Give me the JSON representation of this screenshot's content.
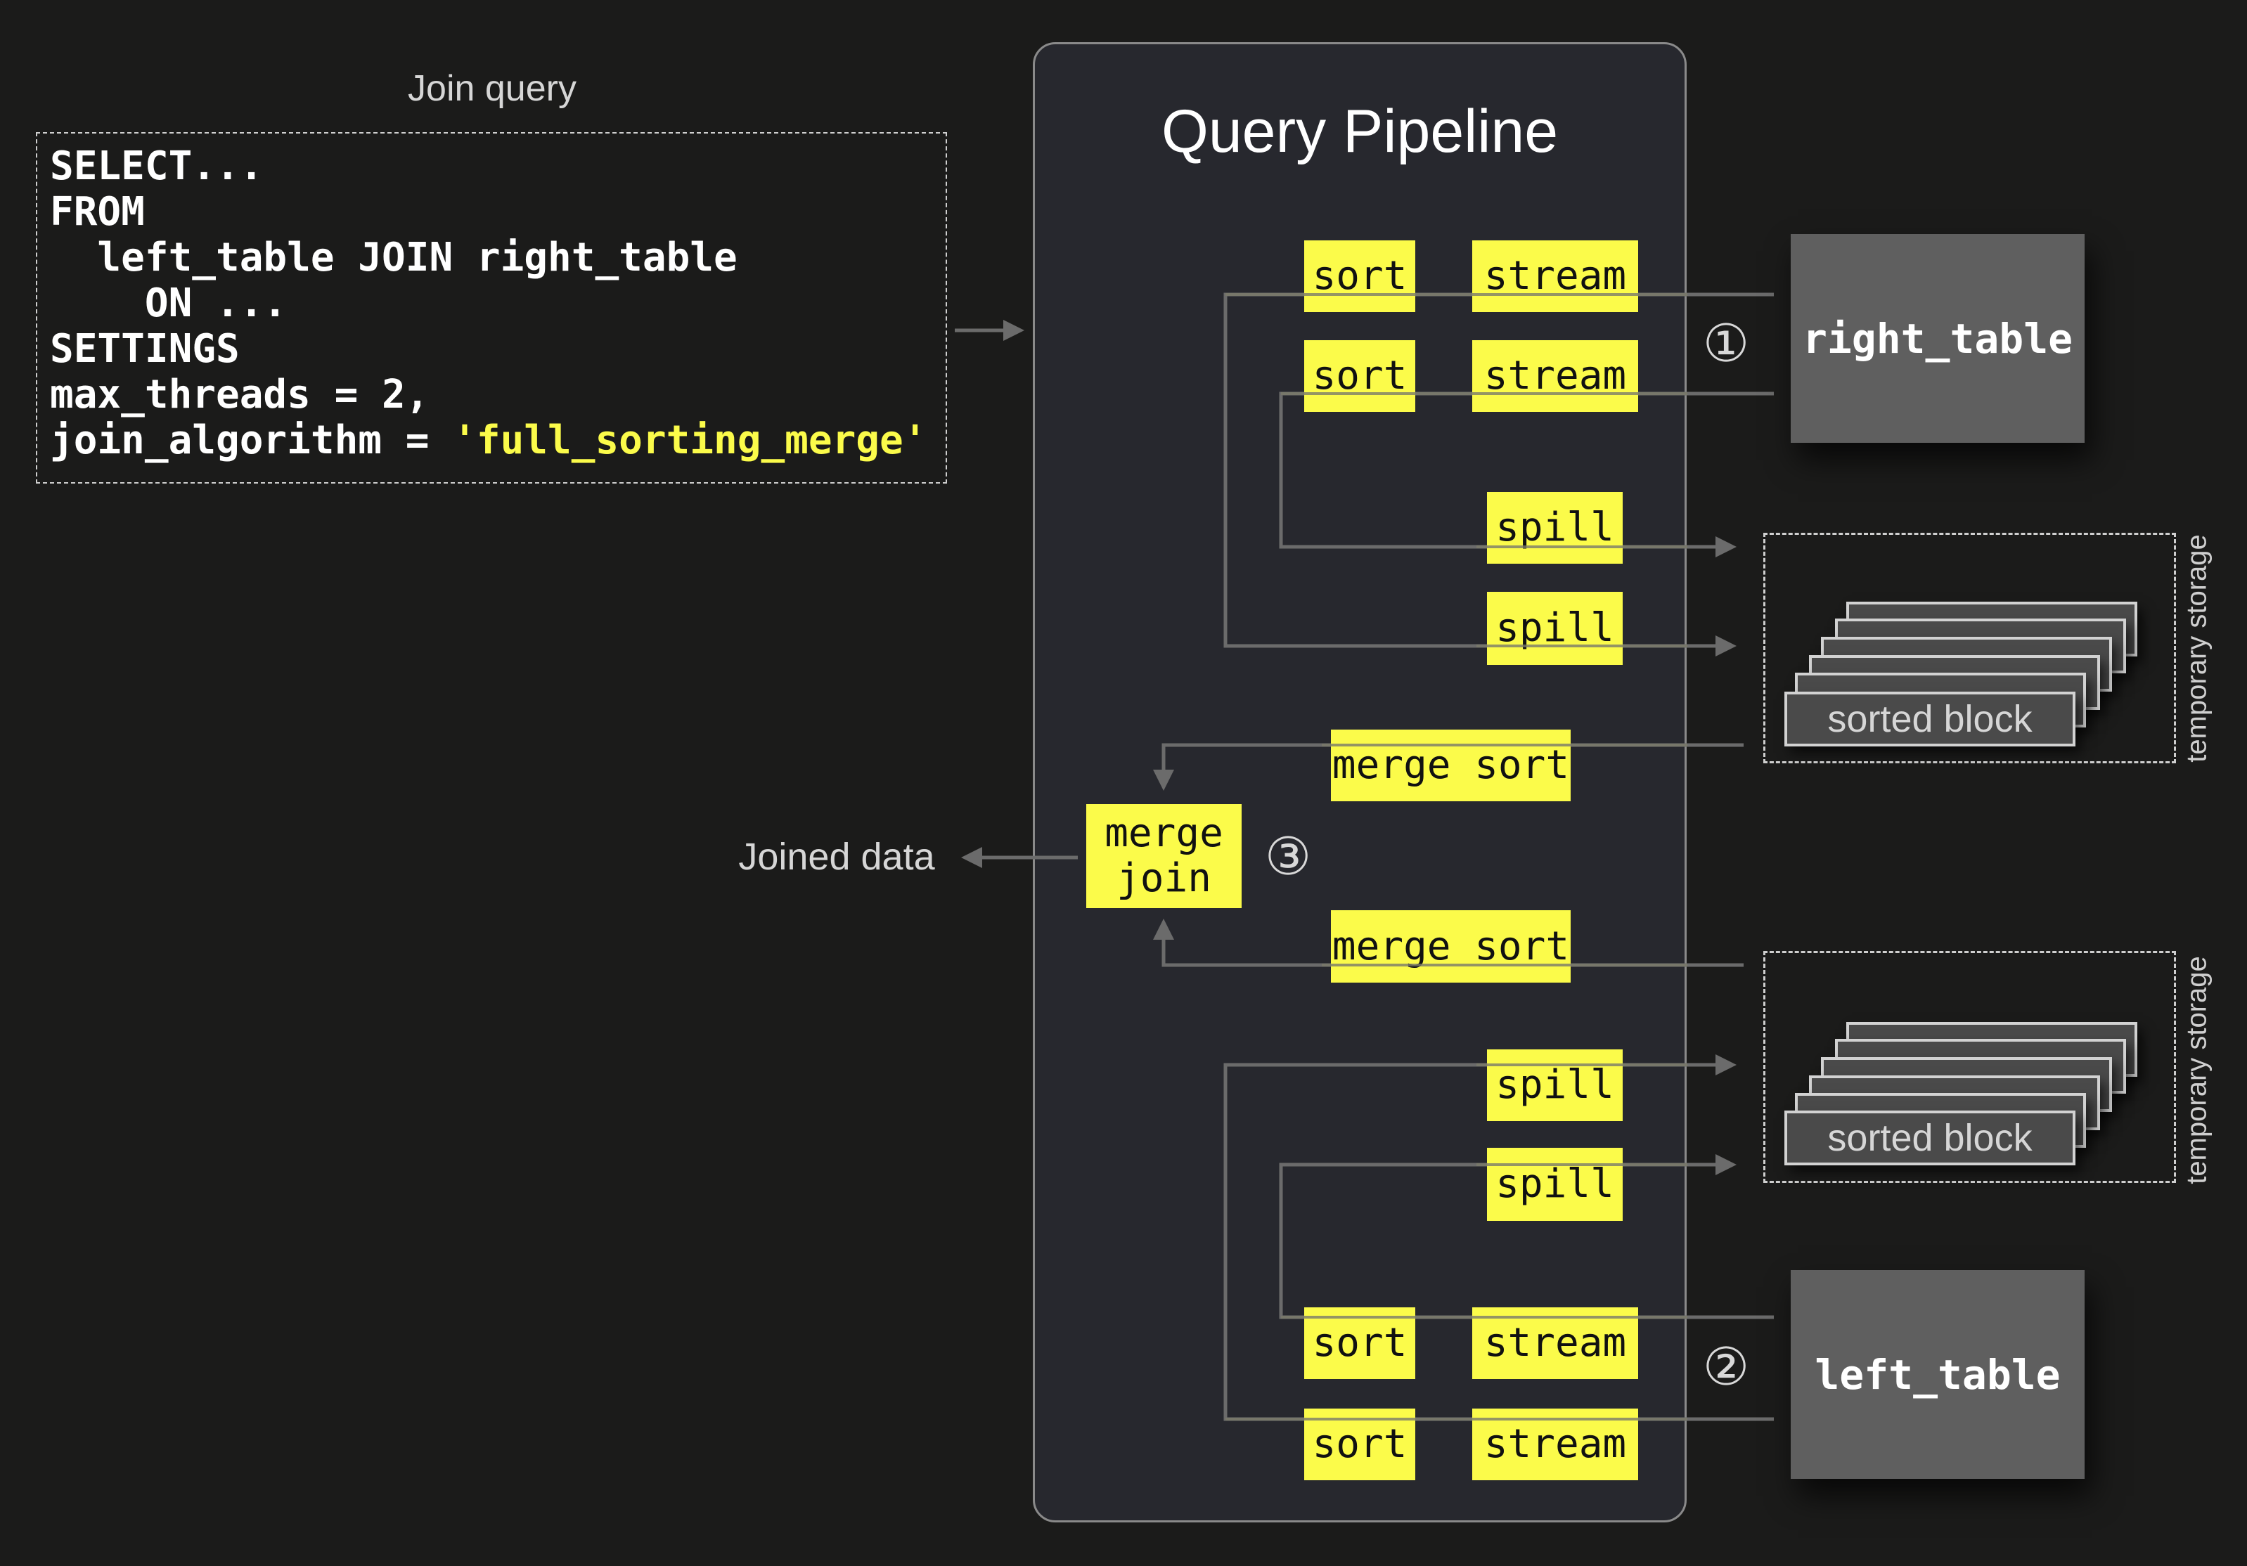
{
  "query": {
    "label": "Join query",
    "lines": [
      {
        "text": "SELECT..."
      },
      {
        "text": "FROM"
      },
      {
        "text": "  left_table JOIN right_table"
      },
      {
        "text": "    ON ..."
      },
      {
        "text": "SETTINGS"
      },
      {
        "text": "max_threads = 2,"
      },
      {
        "prefix": "join_algorithm = ",
        "highlight": "'full_sorting_merge'"
      }
    ]
  },
  "pipeline": {
    "title": "Query Pipeline",
    "right_side": {
      "rows": [
        {
          "sort": "sort",
          "stream": "stream"
        },
        {
          "sort": "sort",
          "stream": "stream"
        }
      ],
      "spills": [
        "spill",
        "spill"
      ],
      "merge_sort": "merge sort"
    },
    "merge_join": {
      "line1": "merge",
      "line2": "join"
    },
    "left_side": {
      "merge_sort": "merge sort",
      "spills": [
        "spill",
        "spill"
      ],
      "rows": [
        {
          "sort": "sort",
          "stream": "stream"
        },
        {
          "sort": "sort",
          "stream": "stream"
        }
      ]
    }
  },
  "steps": {
    "one": "①",
    "two": "②",
    "three": "③"
  },
  "tables": {
    "right": "right_table",
    "left": "left_table"
  },
  "temporary_storage": [
    {
      "label": "temporary storage",
      "block_label": "sorted block"
    },
    {
      "label": "temporary storage",
      "block_label": "sorted block"
    }
  ],
  "output": {
    "label": "Joined data"
  },
  "colors": {
    "background": "#1b1b1a",
    "panel": "#27282e",
    "operator": "#fbfb4a",
    "table": "#5f5f5f",
    "wire": "#6b6b6b"
  }
}
